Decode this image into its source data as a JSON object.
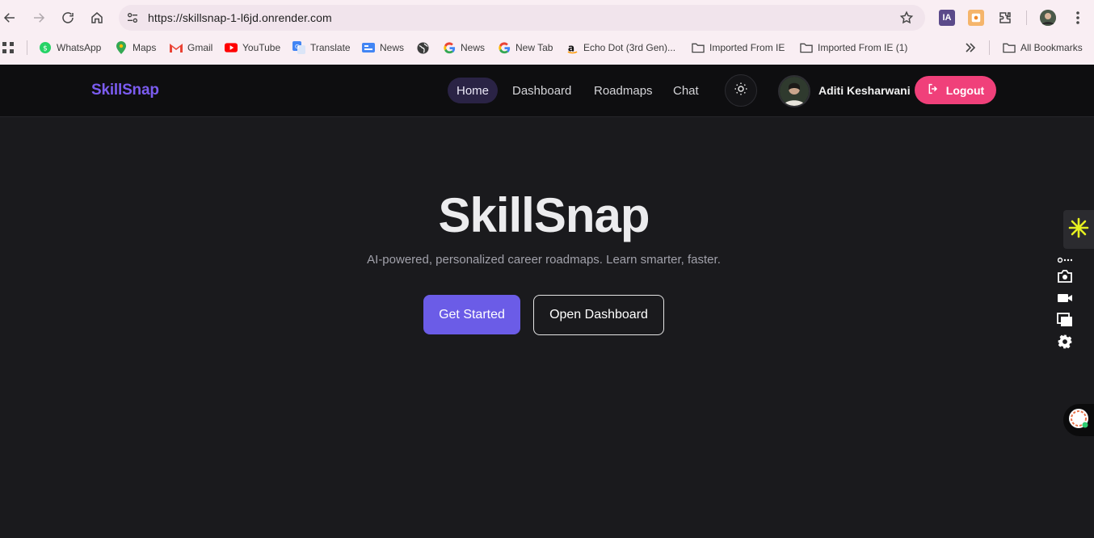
{
  "browser": {
    "url": "https://skillsnap-1-l6jd.onrender.com",
    "extensions": [
      "IA"
    ],
    "bookmarks": [
      {
        "label": "WhatsApp",
        "icon": "whatsapp-icon"
      },
      {
        "label": "Maps",
        "icon": "maps-icon"
      },
      {
        "label": "Gmail",
        "icon": "gmail-icon"
      },
      {
        "label": "YouTube",
        "icon": "youtube-icon"
      },
      {
        "label": "Translate",
        "icon": "translate-icon"
      },
      {
        "label": "News",
        "icon": "google-news-icon"
      },
      {
        "label": "",
        "icon": "globe-icon"
      },
      {
        "label": "News",
        "icon": "google-icon"
      },
      {
        "label": "New Tab",
        "icon": "google-icon"
      },
      {
        "label": "Echo Dot (3rd Gen)...",
        "icon": "amazon-icon"
      },
      {
        "label": "Imported From IE",
        "icon": "folder-icon"
      },
      {
        "label": "Imported From IE (1)",
        "icon": "folder-icon"
      }
    ],
    "all_bookmarks": "All Bookmarks"
  },
  "app": {
    "brand": "SkillSnap",
    "nav": [
      {
        "label": "Home",
        "active": true
      },
      {
        "label": "Dashboard",
        "active": false
      },
      {
        "label": "Roadmaps",
        "active": false
      },
      {
        "label": "Chat",
        "active": false
      }
    ],
    "user_name": "Aditi Kesharwani",
    "logout_label": "Logout"
  },
  "hero": {
    "title": "SkillSnap",
    "subtitle": "AI-powered, personalized career roadmaps. Learn smarter, faster.",
    "primary_cta": "Get Started",
    "secondary_cta": "Open Dashboard"
  },
  "colors": {
    "brand": "#7b5cf0",
    "primary_button": "#6b5ce7",
    "logout": "#f0407a",
    "background": "#1a1a1d"
  }
}
